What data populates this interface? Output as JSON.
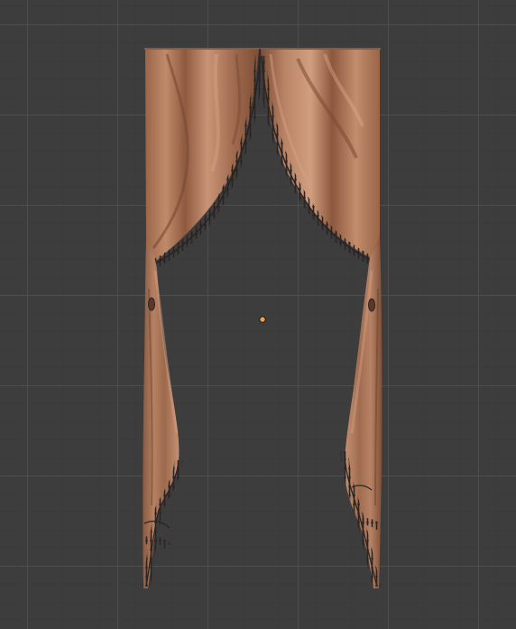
{
  "viewport": {
    "background_color": "#3d3d3d",
    "grid_color": "#505050"
  },
  "scene": {
    "object": "curtain",
    "fabric_color": "#b07b5c",
    "fabric_shadow_color": "#6e4530",
    "fabric_highlight_color": "#d19e80",
    "fringe_color": "#2a2422",
    "origin_marker_color": "#f0a050"
  }
}
